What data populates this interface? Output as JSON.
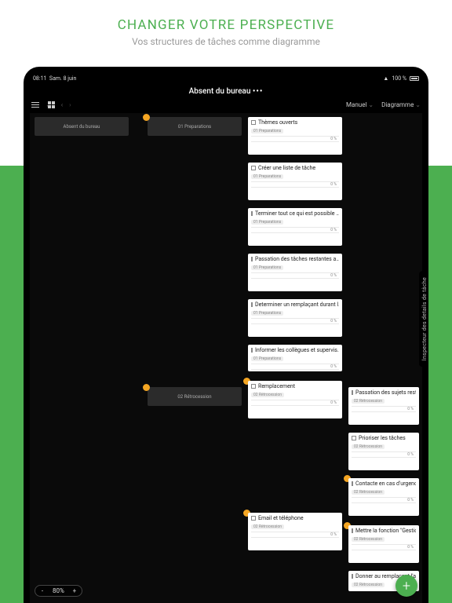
{
  "marketing": {
    "title": "CHANGER VOTRE PERSPECTIVE",
    "subtitle": "Vos structures de tâches comme diagramme"
  },
  "status": {
    "time": "08:11",
    "date": "Sam. 8 juin",
    "battery": "100 %"
  },
  "header": {
    "title": "Absent du bureau",
    "dots": "•••"
  },
  "toolbar": {
    "manual": "Manuel",
    "diagram": "Diagramme"
  },
  "inspector_label": "Inspecteur des details de tâche",
  "zoom": {
    "minus": "-",
    "value": "80%",
    "plus": "+"
  },
  "fab": "+",
  "groups": {
    "root": {
      "title": "Absent du bureau"
    },
    "g1": {
      "title": "01 Preparations"
    },
    "g2": {
      "title": "02 Rétrocession"
    }
  },
  "tags": {
    "prep": "01 Preparations",
    "retro": "02 Rétrocession"
  },
  "percent_zero": "0 %",
  "tasks": {
    "t1": "Thèmes ouverts",
    "t2": "Créer une liste de tâche",
    "t3": "Terminer tout ce qui est possible …",
    "t4": "Passation des tâches restantes a…",
    "t5": "Determiner un remplaçant durant l…",
    "t6": "Informer les collègues et supervis…",
    "t7": "Remplacement",
    "t8": "Email et téléphone",
    "t9": "Passation des sujets resta…",
    "t10": "Prioriser les tâches",
    "t11": "Contacte en cas d'urgence…",
    "t12": "Mettre la fonction \"Gestion…",
    "t13": "Donner au remplaçant l'ac…"
  }
}
